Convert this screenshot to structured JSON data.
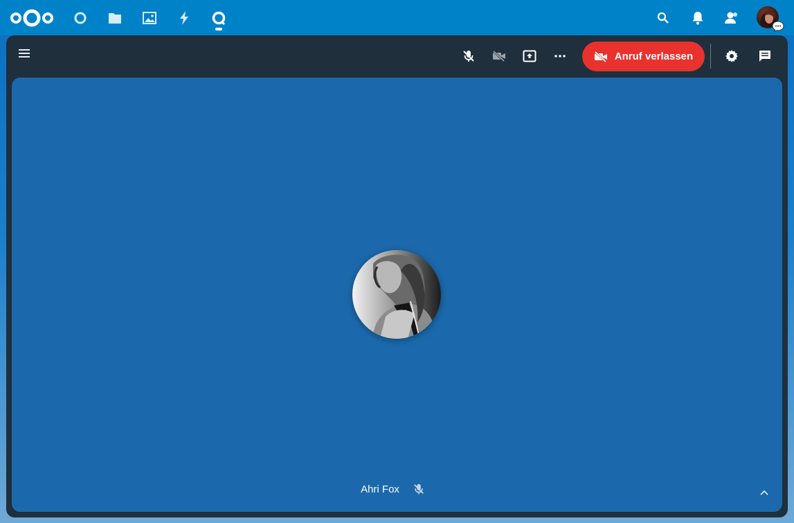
{
  "colors": {
    "topbar": "#0082c9",
    "frame": "#1f2f3c",
    "stage": "#1b69ac",
    "leave_button": "#e9322d"
  },
  "topbar": {
    "logo": "nextcloud-logo",
    "apps": [
      {
        "name": "dashboard",
        "icon": "circle-icon"
      },
      {
        "name": "files",
        "icon": "folder-icon"
      },
      {
        "name": "photos",
        "icon": "image-icon"
      },
      {
        "name": "activity",
        "icon": "lightning-icon"
      },
      {
        "name": "talk",
        "icon": "talk-icon",
        "active": true
      }
    ],
    "right_icons": [
      "search-icon",
      "bell-icon",
      "contacts-icon",
      "avatar"
    ]
  },
  "call": {
    "controls": {
      "mute": "microphone-off-icon",
      "camera": "video-off-icon",
      "share": "screen-share-icon",
      "more": "more-icon",
      "settings": "gear-icon",
      "chat": "chat-icon"
    },
    "leave_label": "Anruf verlassen"
  },
  "participant": {
    "name": "Ahri Fox",
    "muted": true
  }
}
